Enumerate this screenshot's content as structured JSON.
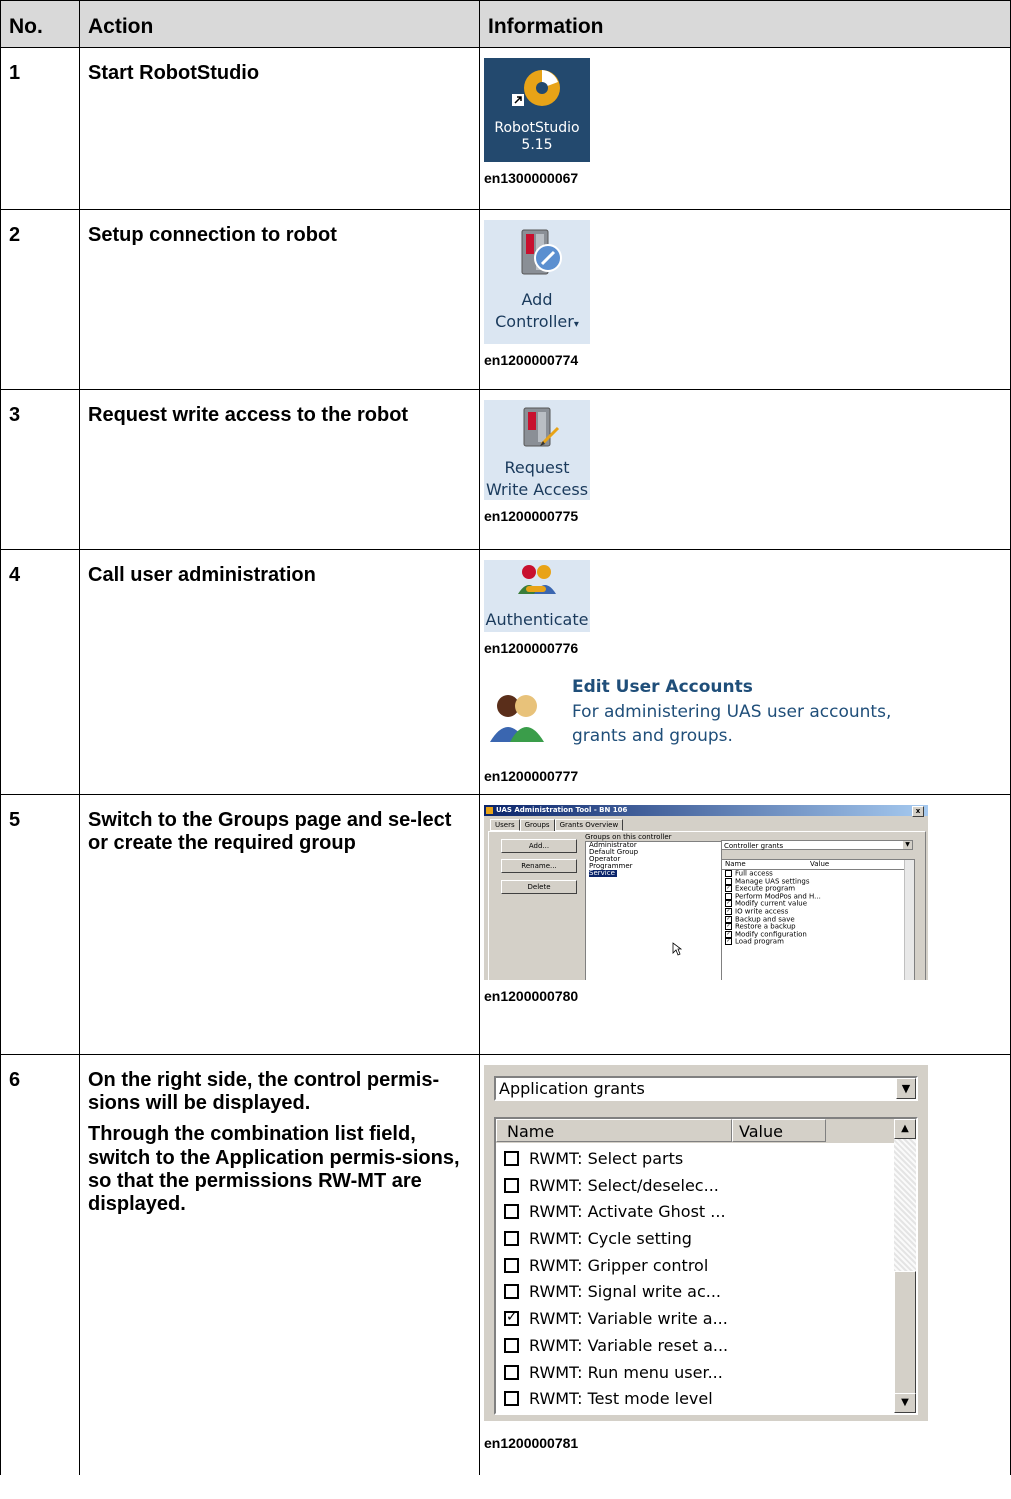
{
  "table": {
    "headers": {
      "no": "No.",
      "action": "Action",
      "information": "Information"
    },
    "rows": [
      {
        "no": "1",
        "action": "Start RobotStudio",
        "caption": "en1300000067",
        "icon_label_1": "RobotStudio",
        "icon_label_2": "5.15",
        "icon": "robotstudio-icon"
      },
      {
        "no": "2",
        "action": "Setup connection to robot",
        "caption": "en1200000774",
        "icon_label_1": "Add",
        "icon_label_2": "Controller",
        "icon": "add-controller-icon"
      },
      {
        "no": "3",
        "action": "Request write access to the robot",
        "caption": "en1200000775",
        "icon_label_1": "Request",
        "icon_label_2": "Write Access",
        "icon": "request-write-access-icon"
      },
      {
        "no": "4",
        "action": "Call user administration",
        "caption": "en1200000776",
        "icon_label_1": "Authenticate",
        "icon": "authenticate-icon",
        "edit_title": "Edit User Accounts",
        "edit_desc_1": "For administering UAS user accounts,",
        "edit_desc_2": "grants and groups.",
        "caption2": "en1200000777"
      },
      {
        "no": "5",
        "action": "Switch to the Groups page and se-lect or create the required group",
        "caption": "en1200000780"
      },
      {
        "no": "6",
        "action_p1": "On the right side, the control permis-sions will be displayed.",
        "action_p2_a": "Through the combination list field, switch to the ",
        "action_p2_b": "Application permis-sions",
        "action_p2_c": ", so that the permissions ",
        "action_p2_d": "RW-MT",
        "action_p2_e": " are displayed.",
        "caption": "en1200000781"
      }
    ]
  },
  "uas_tool": {
    "title": "UAS Administration Tool - BN 106",
    "close": "x",
    "tabs": [
      "Users",
      "Groups",
      "Grants Overview"
    ],
    "buttons": [
      "Add...",
      "Rename...",
      "Delete"
    ],
    "groups_label": "Groups on this controller",
    "groups": [
      "Administrator",
      "Default Group",
      "Operator",
      "Programmer",
      "Service"
    ],
    "selected_group": "Service",
    "combo_value": "Controller grants",
    "col_name": "Name",
    "col_value": "Value",
    "grants": [
      {
        "label": "Full access",
        "checked": false
      },
      {
        "label": "Manage UAS settings",
        "checked": false
      },
      {
        "label": "Execute program",
        "checked": true
      },
      {
        "label": "Perform ModPos and H...",
        "checked": false
      },
      {
        "label": "Modify current value",
        "checked": true
      },
      {
        "label": "IO write access",
        "checked": true
      },
      {
        "label": "Backup and save",
        "checked": true
      },
      {
        "label": "Restore a backup",
        "checked": true
      },
      {
        "label": "Modify configuration",
        "checked": true
      },
      {
        "label": "Load program",
        "checked": true
      }
    ]
  },
  "app_grants": {
    "combo_value": "Application grants",
    "col_name": "Name",
    "col_value": "Value",
    "items": [
      {
        "label": "RWMT: Select parts",
        "checked": false
      },
      {
        "label": "RWMT: Select/deselec...",
        "checked": false
      },
      {
        "label": "RWMT: Activate Ghost ...",
        "checked": false
      },
      {
        "label": "RWMT: Cycle setting",
        "checked": false
      },
      {
        "label": "RWMT: Gripper control",
        "checked": false
      },
      {
        "label": "RWMT: Signal write ac...",
        "checked": false
      },
      {
        "label": "RWMT: Variable write a...",
        "checked": true
      },
      {
        "label": "RWMT: Variable reset a...",
        "checked": false
      },
      {
        "label": "RWMT: Run menu user...",
        "checked": false
      },
      {
        "label": "RWMT: Test mode level",
        "checked": false
      }
    ]
  }
}
